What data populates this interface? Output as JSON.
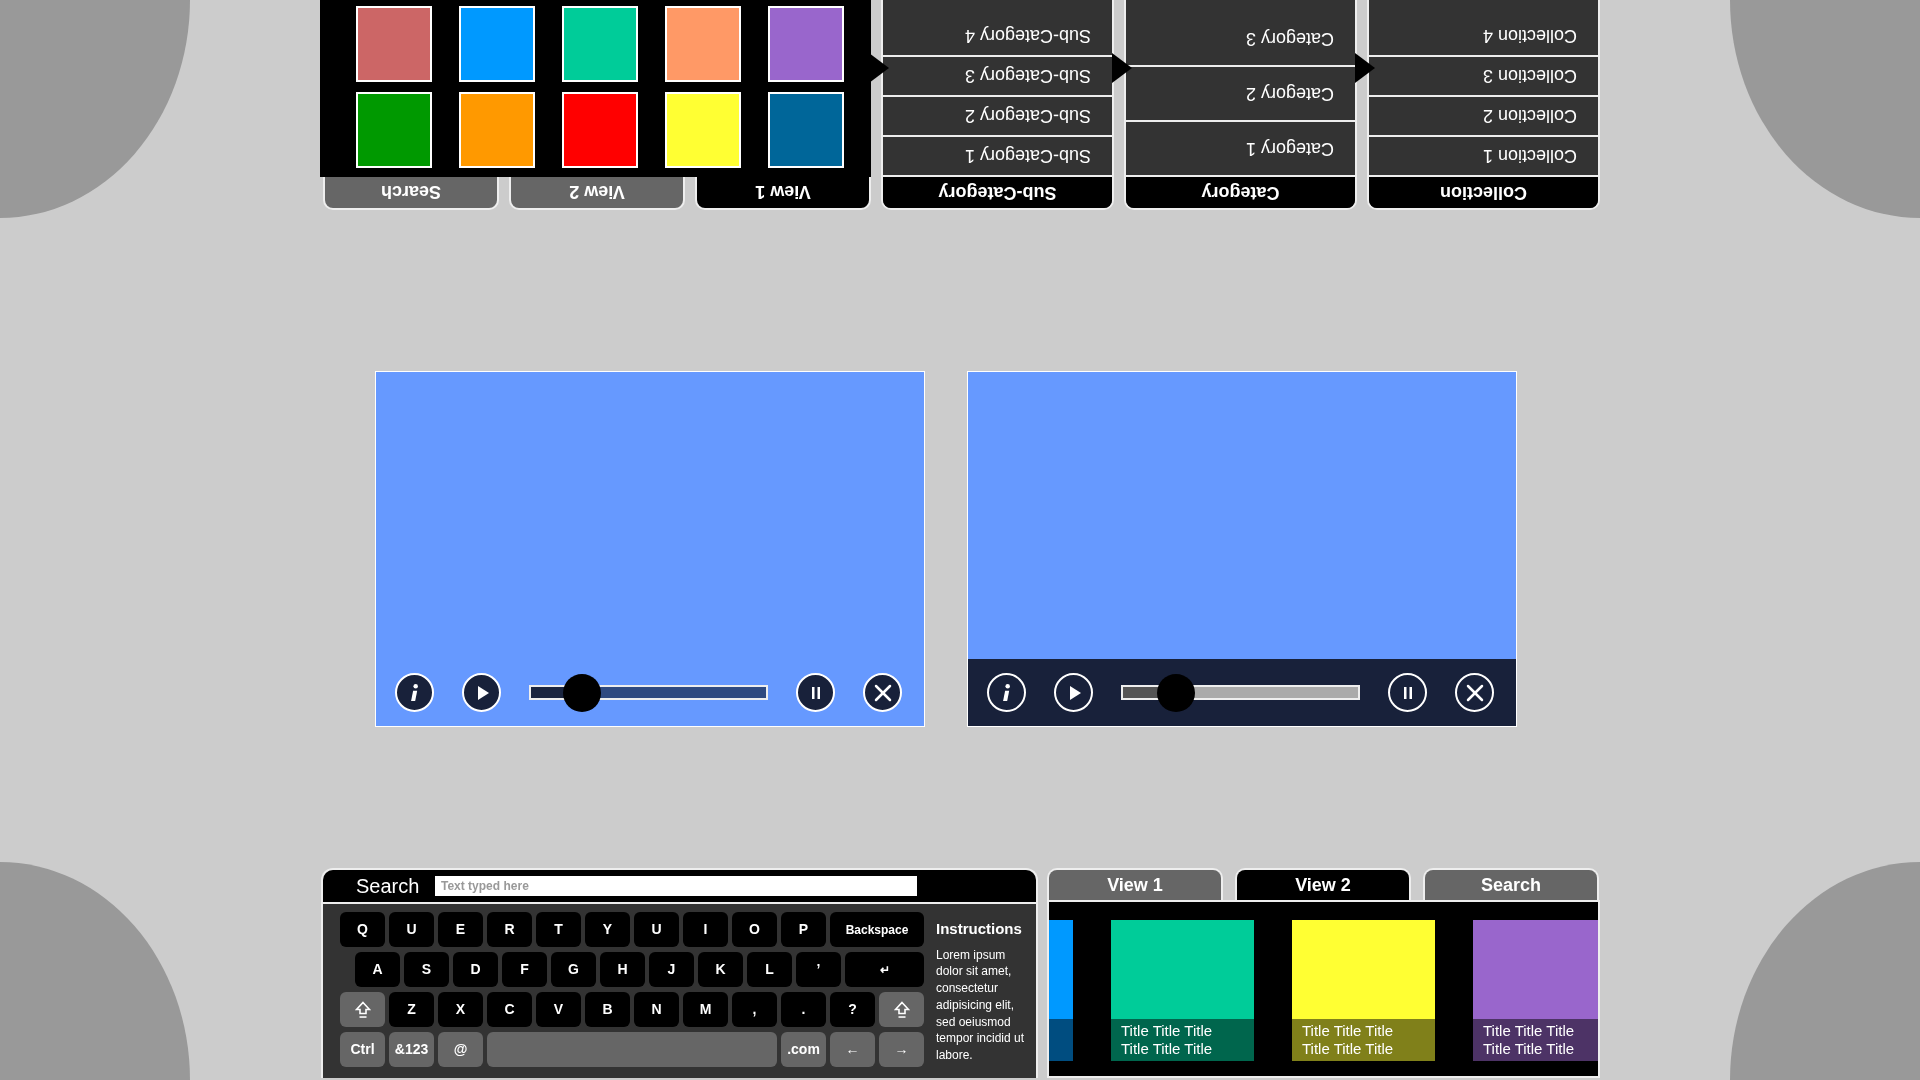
{
  "top_panel": {
    "upside_down": true,
    "columns": [
      {
        "header": "Collection",
        "kind": "compact",
        "rows": [
          {
            "label": "Collection 1"
          },
          {
            "label": "Collection 2"
          },
          {
            "label": "Collection 3"
          },
          {
            "label": "Collection 4"
          }
        ]
      },
      {
        "header": "Category",
        "kind": "tall",
        "rows": [
          {
            "label": "Category 1"
          },
          {
            "label": "Category 2"
          },
          {
            "label": "Category 3"
          }
        ]
      },
      {
        "header": "Sub-Category",
        "kind": "compact",
        "rows": [
          {
            "label": "Sub-Category 1"
          },
          {
            "label": "Sub-Category 2"
          },
          {
            "label": "Sub-Category 3"
          },
          {
            "label": "Sub-Category 4"
          }
        ]
      }
    ],
    "tabs": [
      {
        "label": "View 1",
        "selected": true
      },
      {
        "label": "View 2",
        "selected": false
      },
      {
        "label": "Search",
        "selected": false
      }
    ],
    "swatches": [
      {
        "color": "#006699"
      },
      {
        "color": "#ffff33"
      },
      {
        "color": "#ff0000"
      },
      {
        "color": "#ff9900"
      },
      {
        "color": "#009900"
      },
      {
        "color": "#9966cc"
      },
      {
        "color": "#ff9966"
      },
      {
        "color": "#00cc99"
      },
      {
        "color": "#0099ff"
      },
      {
        "color": "#cc6666"
      }
    ]
  },
  "videos": [
    {
      "kind": "overlay",
      "level": 0.22
    },
    {
      "kind": "bar",
      "level": 0.23
    }
  ],
  "keyboard": {
    "search_label": "Search",
    "placeholder": "Text typed here",
    "rows": [
      {
        "keys": [
          {
            "label": "Q",
            "kind": "letter"
          },
          {
            "label": "U",
            "kind": "letter"
          },
          {
            "label": "E",
            "kind": "letter"
          },
          {
            "label": "R",
            "kind": "letter"
          },
          {
            "label": "T",
            "kind": "letter"
          },
          {
            "label": "Y",
            "kind": "letter"
          },
          {
            "label": "U",
            "kind": "letter"
          },
          {
            "label": "I",
            "kind": "letter"
          },
          {
            "label": "O",
            "kind": "letter"
          },
          {
            "label": "P",
            "kind": "letter"
          },
          {
            "label": "Backspace",
            "kind": "wide"
          }
        ]
      },
      {
        "keys": [
          {
            "label": "A",
            "kind": "letter"
          },
          {
            "label": "S",
            "kind": "letter"
          },
          {
            "label": "D",
            "kind": "letter"
          },
          {
            "label": "F",
            "kind": "letter"
          },
          {
            "label": "G",
            "kind": "letter"
          },
          {
            "label": "H",
            "kind": "letter"
          },
          {
            "label": "J",
            "kind": "letter"
          },
          {
            "label": "K",
            "kind": "letter"
          },
          {
            "label": "L",
            "kind": "letter"
          },
          {
            "label": "’",
            "kind": "letter"
          },
          {
            "label": "↵",
            "kind": "wide"
          }
        ]
      },
      {
        "keys": [
          {
            "kind": "shift"
          },
          {
            "label": "Z",
            "kind": "letter"
          },
          {
            "label": "X",
            "kind": "letter"
          },
          {
            "label": "C",
            "kind": "letter"
          },
          {
            "label": "V",
            "kind": "letter"
          },
          {
            "label": "B",
            "kind": "letter"
          },
          {
            "label": "N",
            "kind": "letter"
          },
          {
            "label": "M",
            "kind": "letter"
          },
          {
            "label": ",",
            "kind": "letter"
          },
          {
            "label": ".",
            "kind": "letter"
          },
          {
            "label": "?",
            "kind": "letter"
          },
          {
            "kind": "shift"
          }
        ]
      },
      {
        "keys": [
          {
            "label": "Ctrl",
            "kind": "function"
          },
          {
            "label": "&123",
            "kind": "function"
          },
          {
            "label": "@",
            "kind": "function"
          },
          {
            "kind": "space"
          },
          {
            "label": ".com",
            "kind": "function"
          },
          {
            "label": "←",
            "kind": "function"
          },
          {
            "label": "→",
            "kind": "function"
          }
        ]
      }
    ],
    "instructions": {
      "title": "Instructions",
      "body": "Lorem ipsum dolor sit amet, consectetur adipisicing elit, sed oeiusmod tempor incidid ut labore."
    }
  },
  "browser": {
    "tabs": [
      {
        "label": "View 1",
        "selected": false
      },
      {
        "label": "View 2",
        "selected": true
      },
      {
        "label": "Search",
        "selected": false
      }
    ],
    "tiles": [
      {
        "color": "#0099ff"
      },
      {
        "color": "#00cc99",
        "title": "Title Title Title Title Title Title"
      },
      {
        "color": "#ffff33",
        "title": "Title Title Title Title Title Title"
      },
      {
        "color": "#9966cc",
        "title": "Title Title Title Title Title Title"
      }
    ]
  }
}
